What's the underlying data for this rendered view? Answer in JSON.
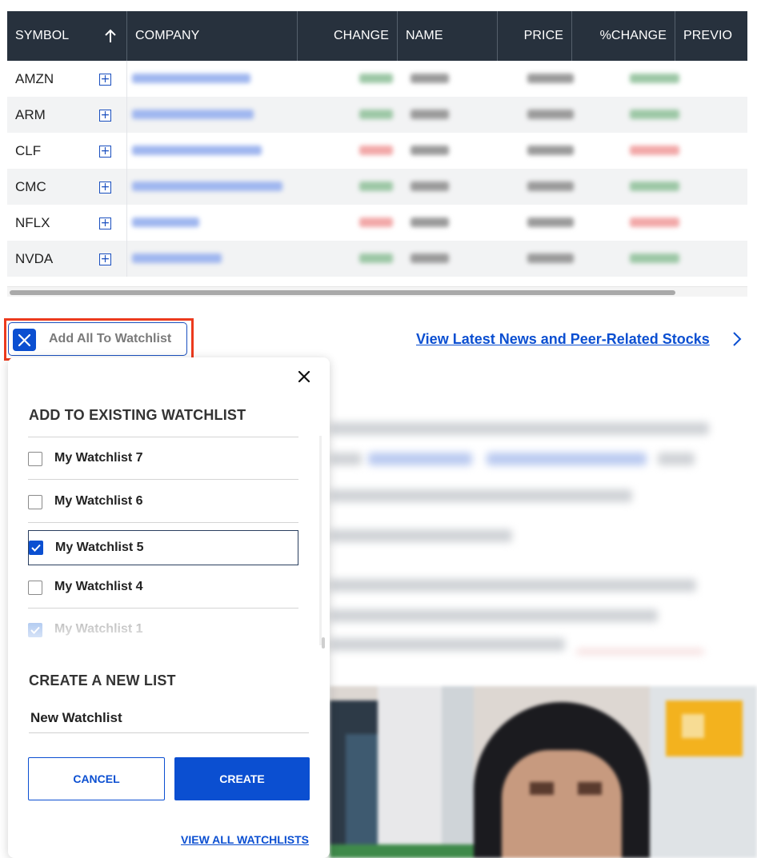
{
  "table": {
    "columns": [
      {
        "label": "SYMBOL",
        "width": 150,
        "align": "left"
      },
      {
        "label": "COMPANY",
        "width": 213,
        "align": "left"
      },
      {
        "label": "CHANGE",
        "width": 125,
        "align": "right"
      },
      {
        "label": "NAME",
        "width": 125,
        "align": "left"
      },
      {
        "label": "PRICE",
        "width": 93,
        "align": "right"
      },
      {
        "label": "%CHANGE",
        "width": 129,
        "align": "right"
      },
      {
        "label": "PREVIO",
        "width": 125,
        "align": "left"
      }
    ],
    "rows": [
      {
        "symbol": "AMZN",
        "trend": "up"
      },
      {
        "symbol": "ARM",
        "trend": "up"
      },
      {
        "symbol": "CLF",
        "trend": "down"
      },
      {
        "symbol": "CMC",
        "trend": "up"
      },
      {
        "symbol": "NFLX",
        "trend": "down"
      },
      {
        "symbol": "NVDA",
        "trend": "up"
      }
    ]
  },
  "add_all": {
    "label": "Add All To Watchlist"
  },
  "news_link": {
    "label": "View Latest News and Peer-Related Stocks"
  },
  "popup": {
    "title": "ADD TO EXISTING WATCHLIST",
    "watchlists": [
      {
        "label": "My Watchlist 7",
        "checked": false,
        "selected": false,
        "faded": false
      },
      {
        "label": "My Watchlist 6",
        "checked": false,
        "selected": false,
        "faded": false
      },
      {
        "label": "My Watchlist 5",
        "checked": true,
        "selected": true,
        "faded": false
      },
      {
        "label": "My Watchlist 4",
        "checked": false,
        "selected": false,
        "faded": false
      },
      {
        "label": "My Watchlist 1",
        "checked": true,
        "selected": false,
        "faded": true
      }
    ],
    "create_title": "CREATE A NEW LIST",
    "new_list_value": "New Watchlist",
    "cancel_label": "CANCEL",
    "create_label": "CREATE",
    "view_all_label": "VIEW ALL WATCHLISTS"
  },
  "colors": {
    "header_bg": "#27313d",
    "accent_blue": "#0b4fd1",
    "highlight_red": "#ec3a1d",
    "row_alt_bg": "#f2f3f4"
  }
}
